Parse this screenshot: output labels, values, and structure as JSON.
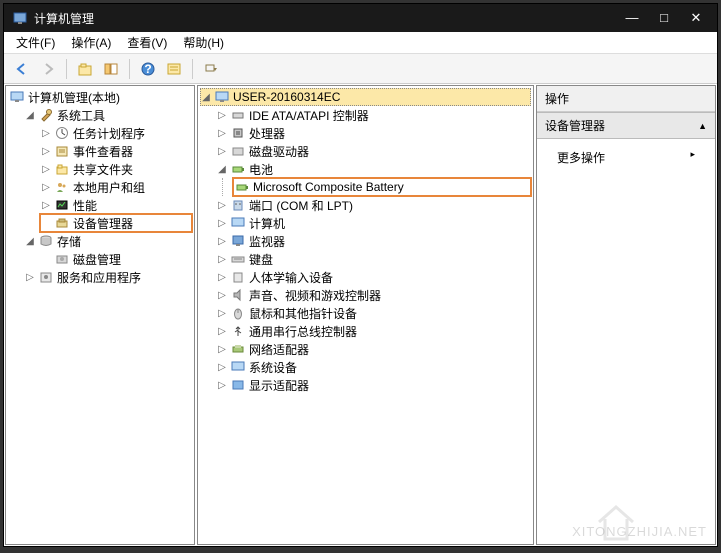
{
  "title": "计算机管理",
  "menu": {
    "file": "文件(F)",
    "action": "操作(A)",
    "view": "查看(V)",
    "help": "帮助(H)"
  },
  "left_tree": {
    "root": "计算机管理(本地)",
    "sys_tools": {
      "label": "系统工具",
      "items": [
        "任务计划程序",
        "事件查看器",
        "共享文件夹",
        "本地用户和组",
        "性能",
        "设备管理器"
      ]
    },
    "storage": {
      "label": "存储",
      "disk": "磁盘管理"
    },
    "services": "服务和应用程序"
  },
  "device_tree": {
    "root": "USER-20160314EC",
    "ide": "IDE ATA/ATAPI 控制器",
    "cpu": "处理器",
    "drive": "磁盘驱动器",
    "battery": "电池",
    "battery_child": "Microsoft Composite Battery",
    "ports": "端口 (COM 和 LPT)",
    "computer": "计算机",
    "monitor": "监视器",
    "keyboard": "键盘",
    "hid": "人体学输入设备",
    "audio": "声音、视频和游戏控制器",
    "mouse": "鼠标和其他指针设备",
    "usb": "通用串行总线控制器",
    "network": "网络适配器",
    "sysdev": "系统设备",
    "display": "显示适配器"
  },
  "right": {
    "header": "操作",
    "section": "设备管理器",
    "more": "更多操作"
  },
  "watermark": "XITONGZHIJIA.NET"
}
